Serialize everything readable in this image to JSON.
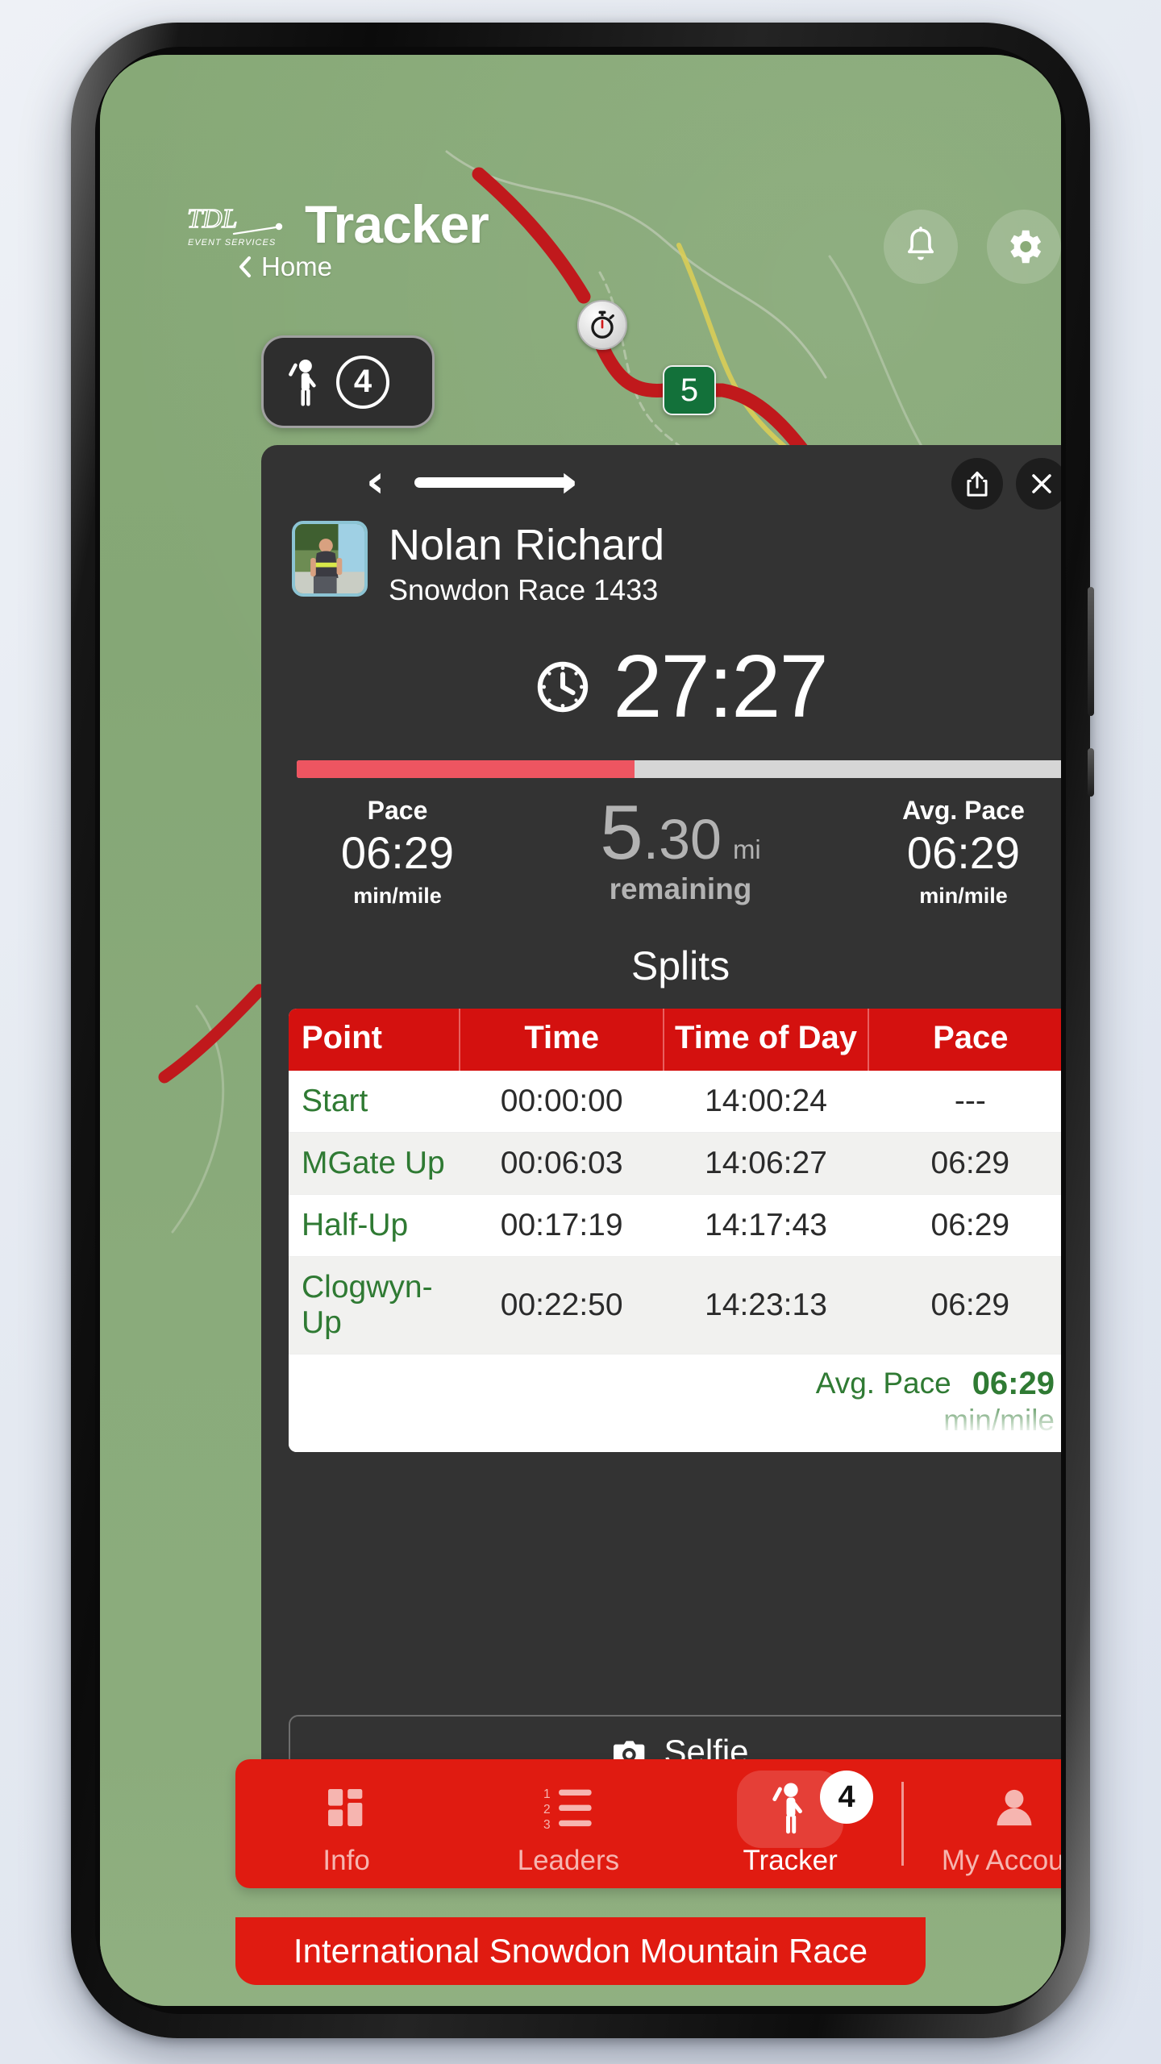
{
  "header": {
    "logo_text": "TDL",
    "logo_subtext": "EVENT SERVICES",
    "title": "Tracker",
    "back_label": "Home",
    "bell_icon": "bell-icon",
    "gear_icon": "gear-icon"
  },
  "map": {
    "runner_count": "4",
    "runner_icon": "waving-person-icon",
    "stopwatch_marker": "stopwatch-icon",
    "mile_marker": "5"
  },
  "card": {
    "prev_icon": "chevron-left-icon",
    "next_icon": "chevron-right-icon",
    "share_icon": "share-icon",
    "close_icon": "close-icon",
    "runner_name": "Nolan Richard",
    "runner_race": "Snowdon Race 1433",
    "clock_icon": "clock-icon",
    "elapsed_time": "27:27",
    "progress_percent": 44,
    "pace": {
      "label": "Pace",
      "value": "06:29",
      "unit": "min/mile"
    },
    "avg_pace": {
      "label": "Avg. Pace",
      "value": "06:29",
      "unit": "min/mile"
    },
    "distance": {
      "whole": "5",
      "fraction": ".30",
      "unit": "mi",
      "status": "remaining"
    },
    "splits_title": "Splits",
    "selfie_label": "Selfie",
    "camera_icon": "camera-icon"
  },
  "splits_table": {
    "columns": [
      "Point",
      "Time",
      "Time of Day",
      "Pace"
    ],
    "rows": [
      {
        "point": "Start",
        "time": "00:00:00",
        "time_of_day": "14:00:24",
        "pace": "---"
      },
      {
        "point": "MGate Up",
        "time": "00:06:03",
        "time_of_day": "14:06:27",
        "pace": "06:29"
      },
      {
        "point": "Half-Up",
        "time": "00:17:19",
        "time_of_day": "14:17:43",
        "pace": "06:29"
      },
      {
        "point": "Clogwyn-Up",
        "time": "00:22:50",
        "time_of_day": "14:23:13",
        "pace": "06:29"
      }
    ],
    "footer_label": "Avg. Pace",
    "footer_value": "06:29",
    "footer_unit": "min/mile"
  },
  "bottom_nav": {
    "items": [
      {
        "label": "Info",
        "icon": "grid-info-icon",
        "active": false
      },
      {
        "label": "Leaders",
        "icon": "numbered-list-icon",
        "active": false
      },
      {
        "label": "Tracker",
        "icon": "waving-person-icon",
        "active": true,
        "badge": "4"
      },
      {
        "label": "My Account",
        "icon": "person-icon",
        "active": false
      }
    ]
  },
  "event_banner": {
    "text": "International Snowdon Mountain Race"
  },
  "colors": {
    "brand_red": "#e01b11",
    "table_header_red": "#d4110f",
    "map_green": "#8aab78",
    "card_dark": "#333333",
    "progress_red": "#ee5561",
    "split_green": "#2f7a33"
  }
}
